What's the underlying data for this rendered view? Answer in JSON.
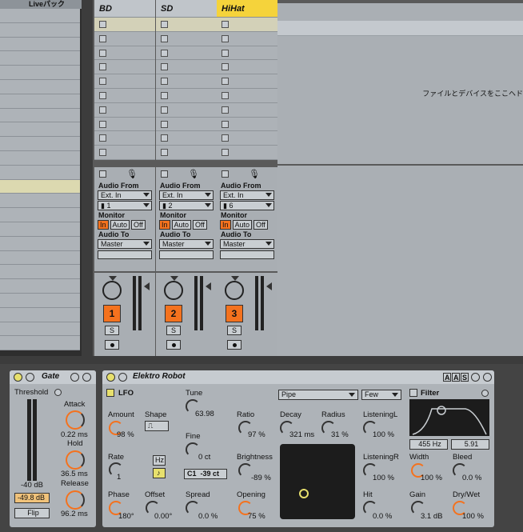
{
  "browser": {
    "header": "Liveパック",
    "row_count": 24,
    "highlight_row": 12
  },
  "tracks": [
    {
      "name": "BD",
      "audio_from": "Ext. In",
      "channel": "1",
      "monitor": [
        "In",
        "Auto",
        "Off"
      ],
      "audio_to_label": "Audio To",
      "audio_to": "Master",
      "number": "1",
      "solo": "S"
    },
    {
      "name": "SD",
      "audio_from": "Ext. In",
      "channel": "2",
      "monitor": [
        "In",
        "Auto",
        "Off"
      ],
      "audio_to_label": "Audio To",
      "audio_to": "Master",
      "number": "2",
      "solo": "S"
    },
    {
      "name": "HiHat",
      "audio_from": "Ext. In",
      "channel": "6",
      "monitor": [
        "In",
        "Auto",
        "Off"
      ],
      "audio_to_label": "Audio To",
      "audio_to": "Master",
      "number": "3",
      "solo": "S"
    }
  ],
  "labels": {
    "audio_from": "Audio From",
    "monitor": "Monitor"
  },
  "drop_message": "ファイルとデバイスをここヘド",
  "colors": {
    "accent_orange": "#f4721e",
    "selected_track": "#f5d33b",
    "device_on": "#e7e06d"
  },
  "gate": {
    "title": "Gate",
    "threshold_label": "Threshold",
    "threshold_scale": "-40 dB",
    "threshold_value": "-49.8 dB",
    "flip": "Flip",
    "attack_label": "Attack",
    "attack_value": "0.22 ms",
    "hold_label": "Hold",
    "hold_value": "36.5 ms",
    "release_label": "Release",
    "release_value": "96.2 ms"
  },
  "robot": {
    "title": "Elektro Robot",
    "header_buttons": [
      "A",
      "A",
      "S"
    ],
    "lfo_label": "LFO",
    "amount_label": "Amount",
    "amount_value": "98 %",
    "shape_label": "Shape",
    "rate_label": "Rate",
    "rate_value": "1",
    "rate_unit": "Hz",
    "rate_sync": "♪",
    "phase_label": "Phase",
    "phase_value": "180°",
    "offset_label": "Offset",
    "offset_value": "0.00°",
    "tune_label": "Tune",
    "tune_value": "63.98",
    "fine_label": "Fine",
    "fine_value": "0 ct",
    "note": "C1",
    "note_ct": "-39 ct",
    "spread_label": "Spread",
    "spread_value": "0.0 %",
    "model": "Pipe",
    "voices": "Few",
    "ratio_label": "Ratio",
    "ratio_value": "97 %",
    "decay_label": "Decay",
    "decay_value": "321 ms",
    "radius_label": "Radius",
    "radius_value": "31 %",
    "brightness_label": "Brightness",
    "brightness_value": "-89 %",
    "opening_label": "Opening",
    "opening_value": "75 %",
    "listeningL_label": "ListeningL",
    "listeningL_value": "100 %",
    "listeningR_label": "ListeningR",
    "listeningR_value": "100 %",
    "hit_label": "Hit",
    "hit_value": "0.0 %",
    "filter_label": "Filter",
    "freq": "455 Hz",
    "q": "5.91",
    "width_label": "Width",
    "width_value": "100 %",
    "bleed_label": "Bleed",
    "bleed_value": "0.0 %",
    "gain_label": "Gain",
    "gain_value": "3.1 dB",
    "drywet_label": "Dry/Wet",
    "drywet_value": "100 %"
  }
}
